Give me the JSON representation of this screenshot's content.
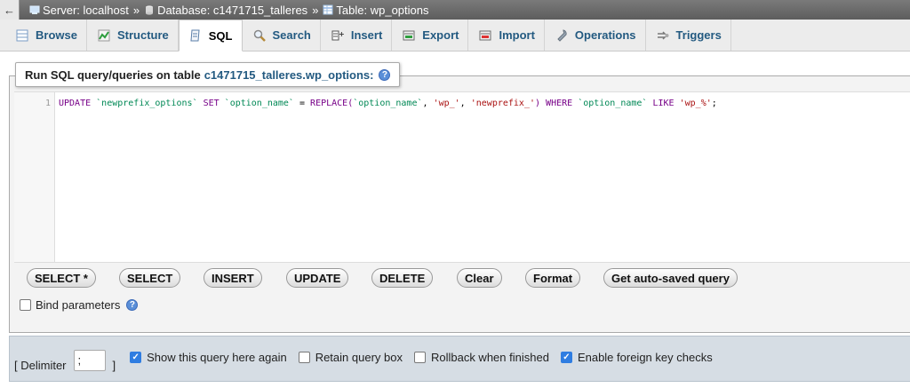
{
  "breadcrumb": {
    "server": "Server: localhost",
    "database": "Database: c1471715_talleres",
    "table": "Table: wp_options",
    "sep": "»"
  },
  "tabs": [
    {
      "label": "Browse",
      "icon": "browse-icon"
    },
    {
      "label": "Structure",
      "icon": "structure-icon"
    },
    {
      "label": "SQL",
      "icon": "sql-icon"
    },
    {
      "label": "Search",
      "icon": "search-icon"
    },
    {
      "label": "Insert",
      "icon": "insert-icon"
    },
    {
      "label": "Export",
      "icon": "export-icon"
    },
    {
      "label": "Import",
      "icon": "import-icon"
    },
    {
      "label": "Operations",
      "icon": "wrench-icon"
    },
    {
      "label": "Triggers",
      "icon": "triggers-icon"
    }
  ],
  "active_tab": "SQL",
  "query_panel": {
    "legend_prefix": "Run SQL query/queries on table",
    "legend_table": "c1471715_talleres.wp_options:",
    "line_number": "1",
    "code": {
      "t1": "UPDATE",
      "t2": "`newprefix_options`",
      "t3": "SET",
      "t4": "`option_name`",
      "t5": "=",
      "t6": "REPLACE(",
      "t7": "`option_name`",
      "t8": ",",
      "t9": "'wp_'",
      "t10": ",",
      "t11": "'newprefix_'",
      "t12": ")",
      "t13": "WHERE",
      "t14": "`option_name`",
      "t15": "LIKE",
      "t16": "'wp_%'",
      "t17": ";"
    }
  },
  "buttons": {
    "select_star": "SELECT *",
    "select": "SELECT",
    "insert": "INSERT",
    "update": "UPDATE",
    "delete": "DELETE",
    "clear": "Clear",
    "format": "Format",
    "autosaved": "Get auto-saved query"
  },
  "bind_parameters": {
    "label": "Bind parameters",
    "checked": false
  },
  "options": {
    "delimiter_open": "[ Delimiter",
    "delimiter_value": ";",
    "delimiter_close": "]",
    "show_query": "Show this query here again",
    "retain_box": "Retain query box",
    "rollback": "Rollback when finished",
    "foreign_keys": "Enable foreign key checks"
  },
  "colors": {
    "link": "#235a81",
    "keyword": "#770088",
    "identifier": "#008855",
    "string": "#aa1111",
    "checkbox_checked": "#2f7de1"
  }
}
